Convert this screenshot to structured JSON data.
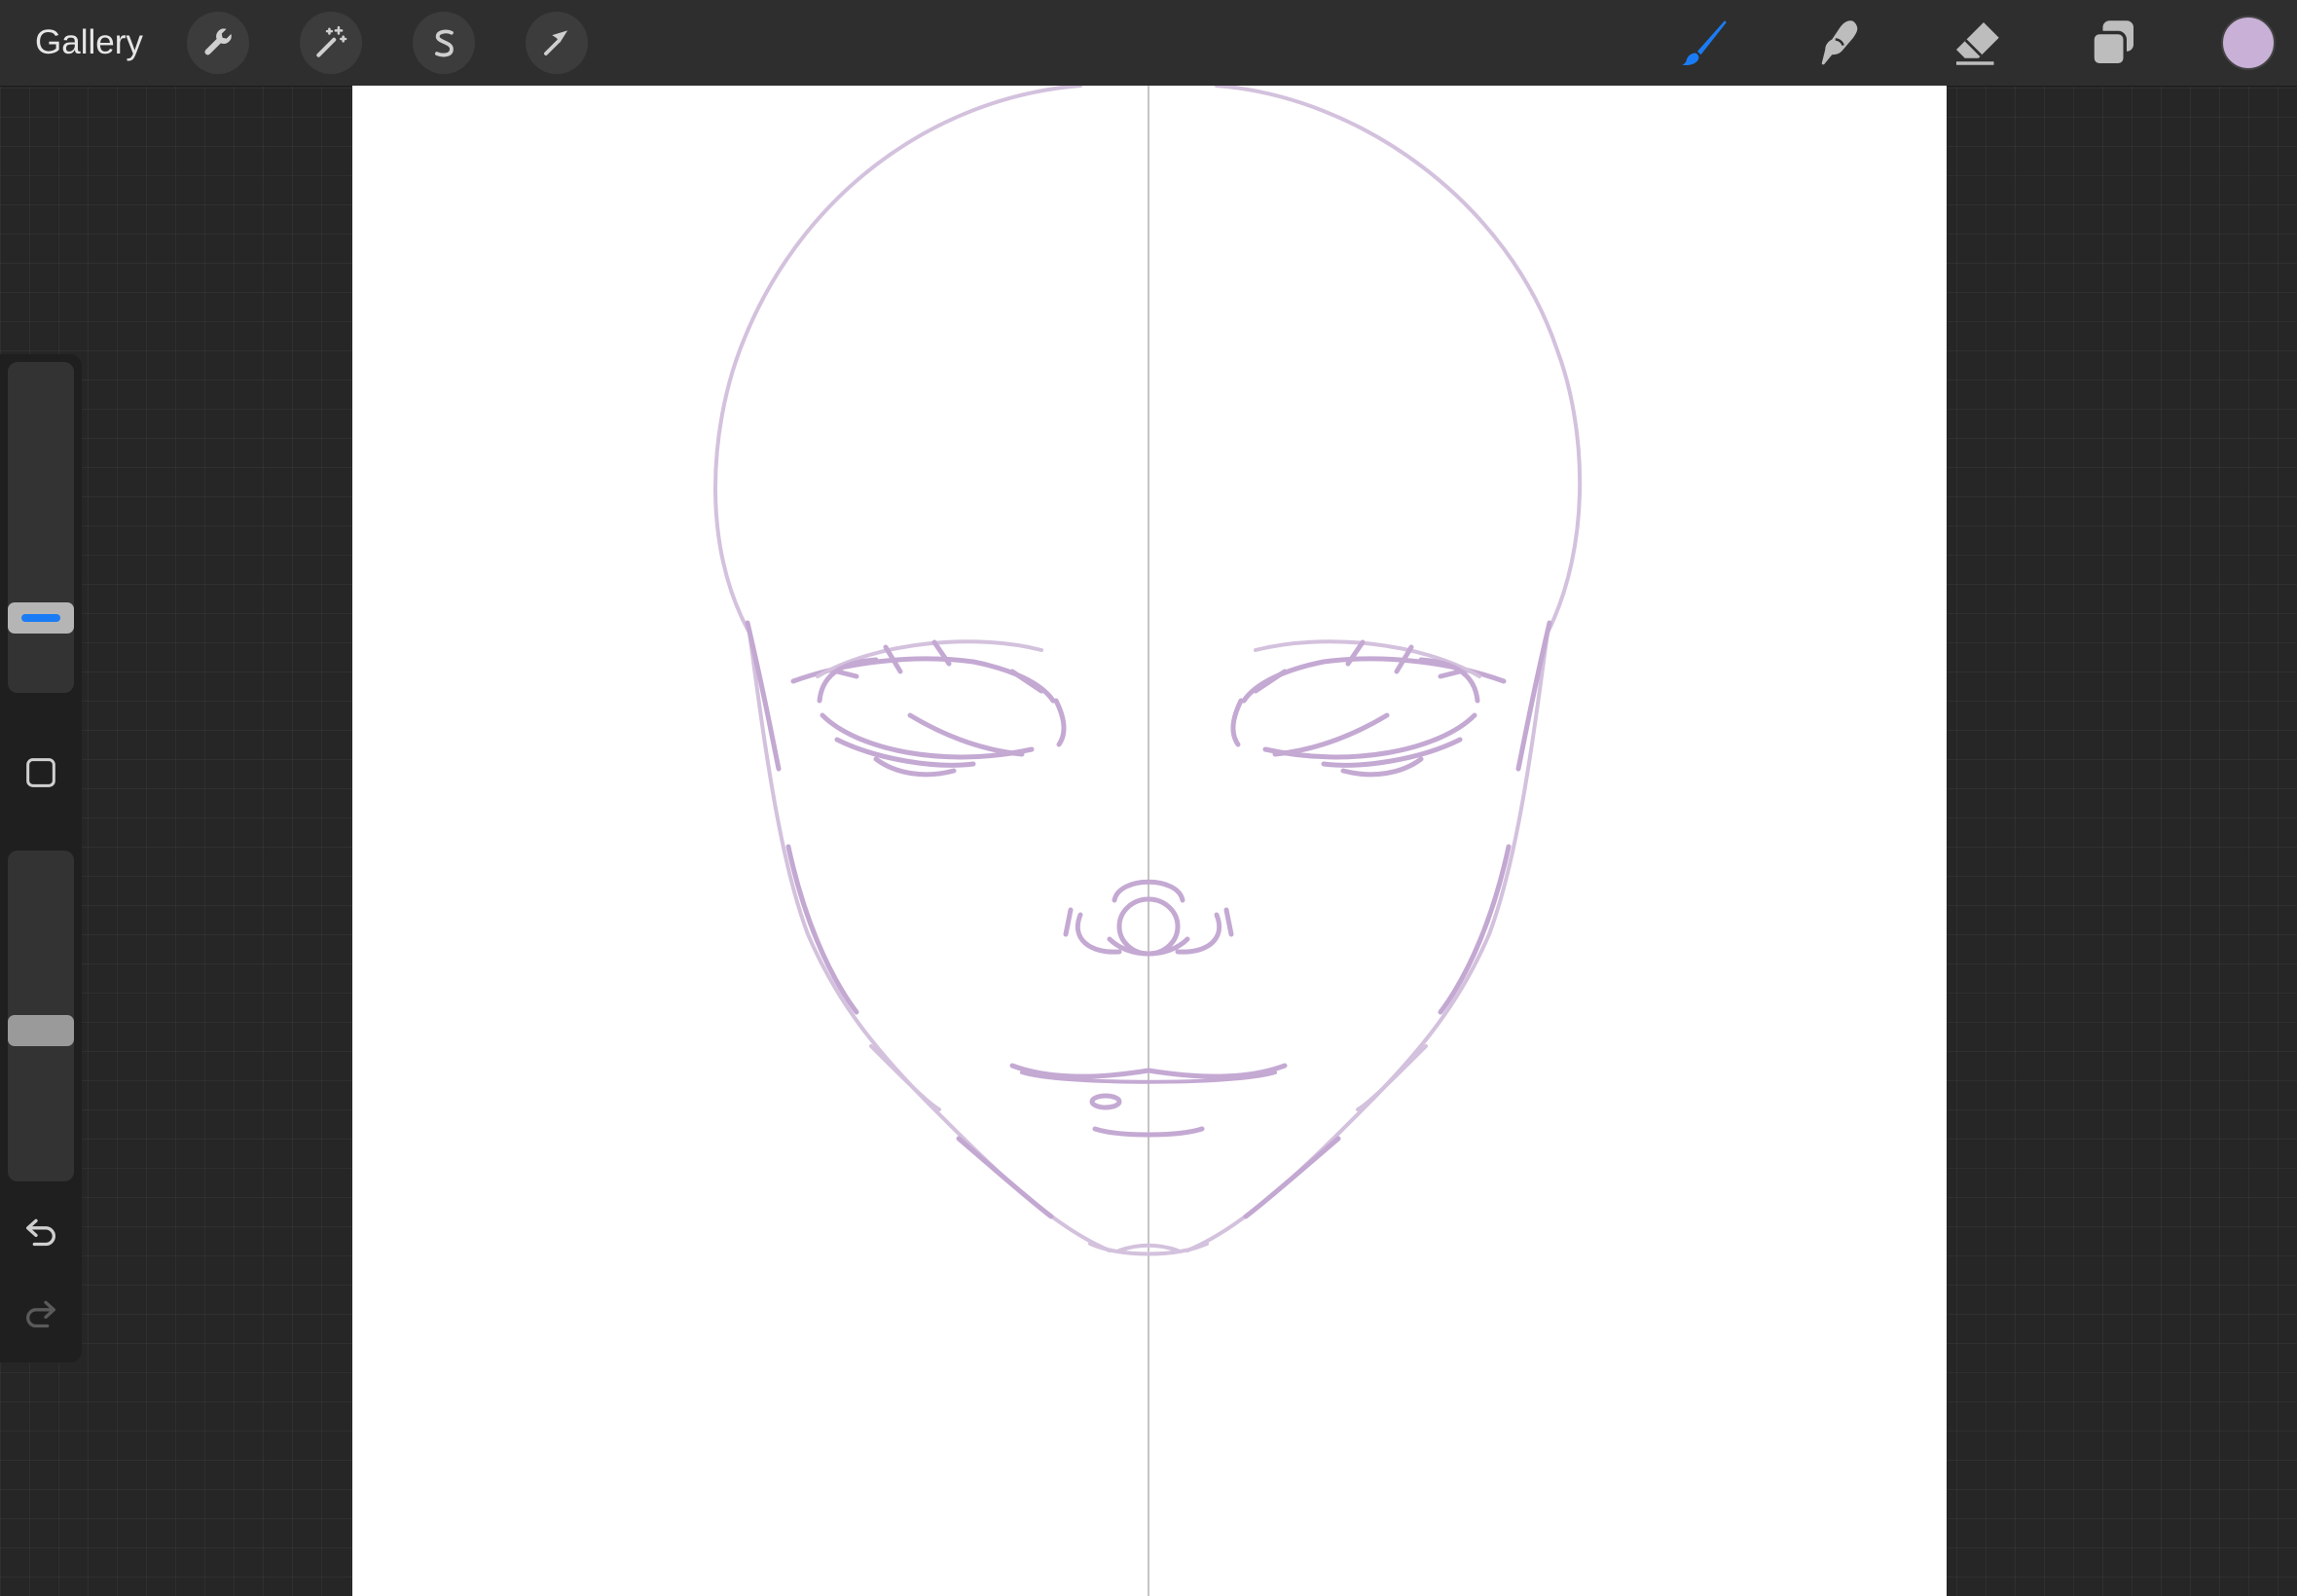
{
  "topbar": {
    "gallery_label": "Gallery",
    "left_tools": [
      {
        "name": "actions",
        "icon": "wrench-icon"
      },
      {
        "name": "adjustments",
        "icon": "magic-wand-icon"
      },
      {
        "name": "selection",
        "icon": "selection-s-icon"
      },
      {
        "name": "transform",
        "icon": "arrow-cursor-icon"
      }
    ],
    "right_tools": [
      {
        "name": "brush",
        "icon": "brush-icon",
        "active": true
      },
      {
        "name": "smudge",
        "icon": "smudge-finger-icon",
        "active": false
      },
      {
        "name": "eraser",
        "icon": "eraser-icon",
        "active": false
      },
      {
        "name": "layers",
        "icon": "layers-icon",
        "active": false
      }
    ],
    "current_color": "#c8b0d6"
  },
  "sidebar": {
    "brush_size_level": 0.18,
    "opacity_level": 0.45,
    "modify_button_icon": "square-icon",
    "undo_icon": "undo-arrow-icon",
    "redo_icon": "redo-arrow-icon"
  },
  "colors": {
    "accent": "#1a7cf5",
    "stroke": "#c7b0d4",
    "stroke_dark": "#b597c6",
    "guide": "#bdbdbd"
  }
}
